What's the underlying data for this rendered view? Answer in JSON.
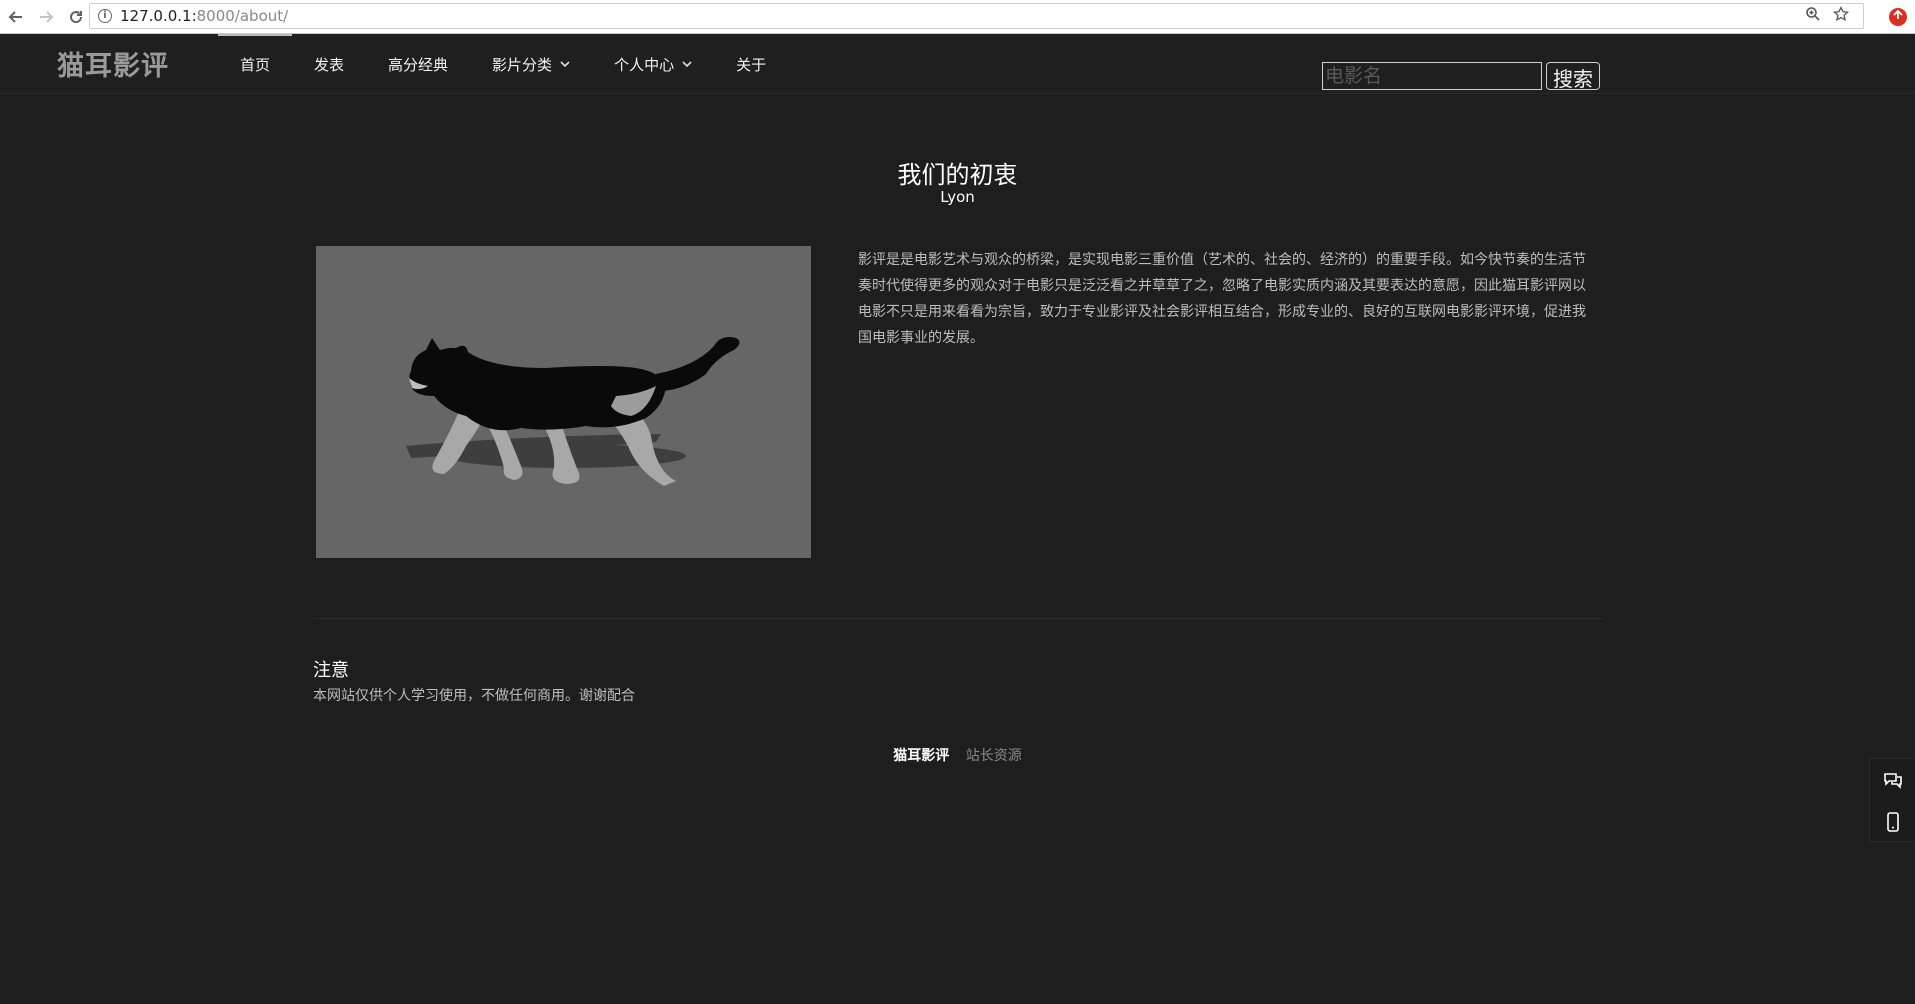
{
  "browser": {
    "url_host": "127.0.0.1:",
    "url_path": "8000/about/",
    "info_glyph": "i"
  },
  "header": {
    "logo": "猫耳影评",
    "menu": [
      {
        "label": "首页",
        "active": true,
        "dropdown": false
      },
      {
        "label": "发表",
        "active": false,
        "dropdown": false
      },
      {
        "label": "高分经典",
        "active": false,
        "dropdown": false
      },
      {
        "label": "影片分类",
        "active": false,
        "dropdown": true
      },
      {
        "label": "个人中心",
        "active": false,
        "dropdown": true
      },
      {
        "label": "关于",
        "active": false,
        "dropdown": false
      }
    ],
    "search": {
      "placeholder": "电影名",
      "button": "搜索"
    }
  },
  "about": {
    "title": "我们的初衷",
    "subtitle": "Lyon",
    "description": "影评是是电影艺术与观众的桥梁，是实现电影三重价值（艺术的、社会的、经济的）的重要手段。如今快节奏的生活节奏时代使得更多的观众对于电影只是泛泛看之并草草了之，忽略了电影实质内涵及其要表达的意愿，因此猫耳影评网以电影不只是用来看看为宗旨，致力于专业影评及社会影评相互结合，形成专业的、良好的互联网电影影评环境，促进我国电影事业的发展。"
  },
  "notice": {
    "title": "注意",
    "text": "本网站仅供个人学习使用，不做任何商用。谢谢配合"
  },
  "footer": {
    "brand": "猫耳影评",
    "link": "站长资源"
  },
  "colors": {
    "background": "#1e1e1e",
    "photo_bg": "#666666"
  },
  "icons": {
    "back": "arrow-left-icon",
    "forward": "arrow-right-icon",
    "reload": "reload-icon",
    "zoom": "zoom-icon",
    "bookmark": "star-icon",
    "chat": "chat-icon",
    "mobile": "mobile-icon"
  }
}
